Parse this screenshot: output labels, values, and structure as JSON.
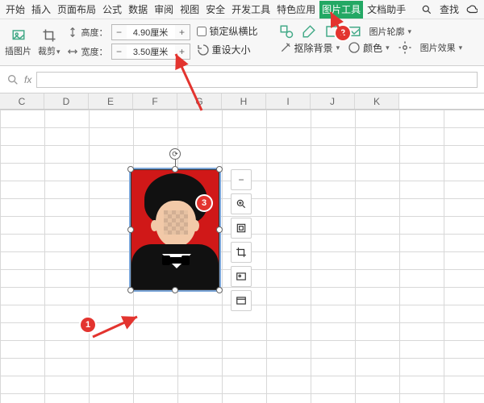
{
  "menu": {
    "items": [
      "开始",
      "插入",
      "页面布局",
      "公式",
      "数据",
      "审阅",
      "视图",
      "安全",
      "开发工具",
      "特色应用",
      "图片工具",
      "文档助手"
    ],
    "active_index": 10,
    "find": "查找"
  },
  "ribbon": {
    "insert_pic": "插图片",
    "crop": "裁剪",
    "height_label": "高度：",
    "height_value": "4.90厘米",
    "width_label": "宽度：",
    "width_value": "3.50厘米",
    "lock_ratio": "锁定纵横比",
    "reset_size": "重设大小",
    "remove_bg": "抠除背景",
    "color": "颜色",
    "outline": "图片轮廓",
    "effects": "图片效果"
  },
  "grid": {
    "columns": [
      "C",
      "D",
      "E",
      "F",
      "G",
      "H",
      "I",
      "J",
      "K"
    ]
  },
  "annotations": {
    "a1": "1",
    "a2": "2",
    "a3": "3"
  }
}
